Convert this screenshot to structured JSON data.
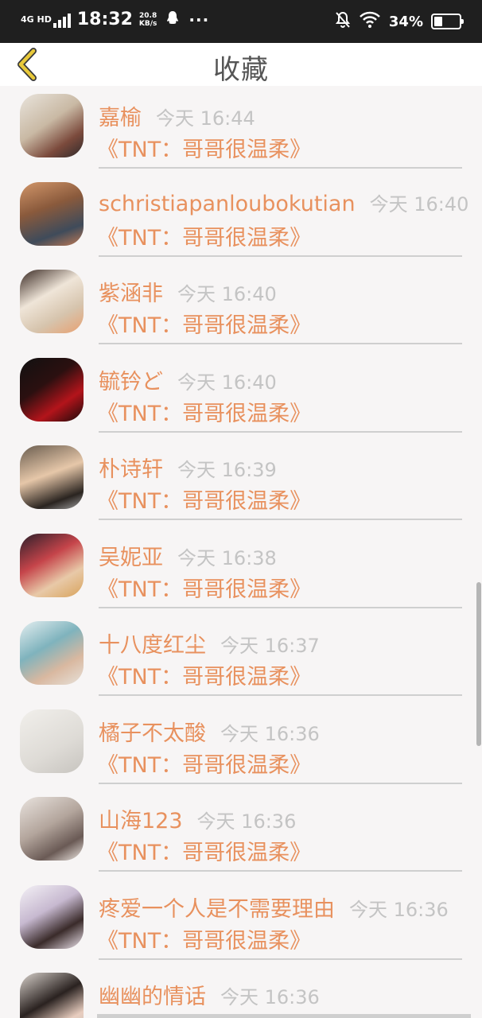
{
  "status_bar": {
    "network": "4G HD",
    "time": "18:32",
    "speed_value": "20.8",
    "speed_unit": "KB/s",
    "more": "···",
    "battery": "34%",
    "battery_level": 0.34,
    "icons": [
      "signal-icon",
      "qq-icon",
      "bell-off-icon",
      "wifi-icon",
      "battery-icon"
    ]
  },
  "header": {
    "title": "收藏",
    "back_icon": "chevron-left-icon",
    "accent": "#e8c93a"
  },
  "colors": {
    "name": "#e8915e",
    "time": "#c4c4c4",
    "background": "#f7f5f5"
  },
  "favorites": [
    {
      "name": "嘉榆",
      "time": "今天 16:44",
      "work": "《TNT：哥哥很温柔》"
    },
    {
      "name": "schristiapanloubokutian",
      "time": "今天 16:40",
      "work": "《TNT：哥哥很温柔》"
    },
    {
      "name": "紫涵非",
      "time": "今天 16:40",
      "work": "《TNT：哥哥很温柔》"
    },
    {
      "name": "毓钤ど",
      "time": "今天 16:40",
      "work": "《TNT：哥哥很温柔》"
    },
    {
      "name": "朴诗轩",
      "time": "今天 16:39",
      "work": "《TNT：哥哥很温柔》"
    },
    {
      "name": "吴妮亚",
      "time": "今天 16:38",
      "work": "《TNT：哥哥很温柔》"
    },
    {
      "name": "十八度红尘",
      "time": "今天 16:37",
      "work": "《TNT：哥哥很温柔》"
    },
    {
      "name": "橘子不太酸",
      "time": "今天 16:36",
      "work": "《TNT：哥哥很温柔》"
    },
    {
      "name": "山海123",
      "time": "今天 16:36",
      "work": "《TNT：哥哥很温柔》"
    },
    {
      "name": "疼爱一个人是不需要理由",
      "time": "今天 16:36",
      "work": "《TNT：哥哥很温柔》"
    },
    {
      "name": "幽幽的情话",
      "time": "今天 16:36",
      "work": "《TNT：哥哥很温柔》"
    }
  ]
}
